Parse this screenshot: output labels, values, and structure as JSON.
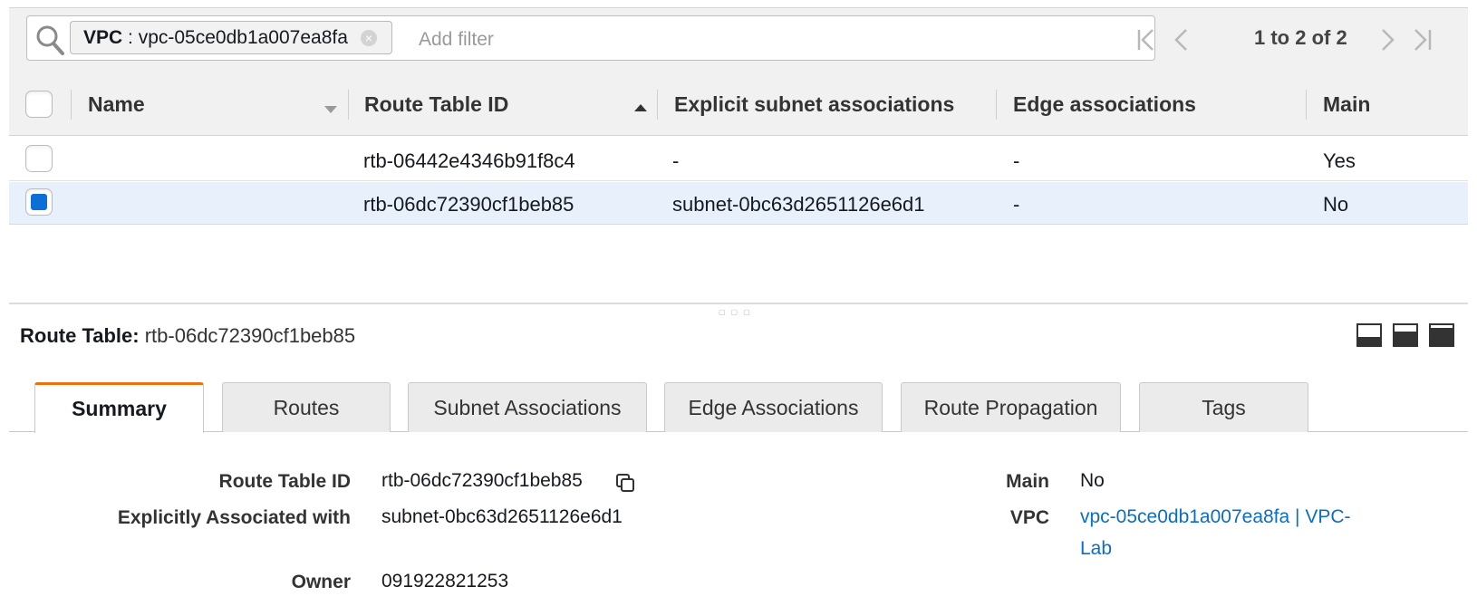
{
  "filter": {
    "token_key": "VPC",
    "token_sep": " : ",
    "token_value": "vpc-05ce0db1a007ea8fa",
    "token_close_glyph": "×",
    "placeholder": "Add filter",
    "icon": "search-icon"
  },
  "pagination": {
    "text": "1 to 2 of 2",
    "icons": [
      "first-page-icon",
      "prev-page-icon",
      "next-page-icon",
      "last-page-icon"
    ]
  },
  "table": {
    "columns": [
      "Name",
      "Route Table ID",
      "Explicit subnet associations",
      "Edge associations",
      "Main"
    ],
    "sort": {
      "name_column": "descending",
      "route_table_id_column": "ascending"
    },
    "rows": [
      {
        "name": "",
        "route_table_id": "rtb-06442e4346b91f8c4",
        "explicit_subnet": "-",
        "edge": "-",
        "main": "Yes",
        "selected": false
      },
      {
        "name": "",
        "route_table_id": "rtb-06dc72390cf1beb85",
        "explicit_subnet": "subnet-0bc63d2651126e6d1",
        "edge": "-",
        "main": "No",
        "selected": true
      }
    ]
  },
  "detail": {
    "title_label": "Route Table:",
    "title_value": "rtb-06dc72390cf1beb85",
    "layout_icons": [
      "layout-bottom-icon",
      "layout-middle-icon",
      "layout-full-icon"
    ],
    "tabs": [
      "Summary",
      "Routes",
      "Subnet Associations",
      "Edge Associations",
      "Route Propagation",
      "Tags"
    ],
    "active_tab": "Summary",
    "summary": {
      "route_table_id_label": "Route Table ID",
      "route_table_id_value": "rtb-06dc72390cf1beb85",
      "explicit_label": "Explicitly Associated with",
      "explicit_value": "subnet-0bc63d2651126e6d1",
      "owner_label": "Owner",
      "owner_value": "091922821253",
      "main_label": "Main",
      "main_value": "No",
      "vpc_label": "VPC",
      "vpc_line1": "vpc-05ce0db1a007ea8fa | VPC-",
      "vpc_line2": "Lab"
    }
  },
  "colors": {
    "accent_tab": "#ec7211",
    "link": "#0b6ec5",
    "selected_row": "#e8f1fb",
    "checkbox_checked": "#0b6fd6"
  }
}
